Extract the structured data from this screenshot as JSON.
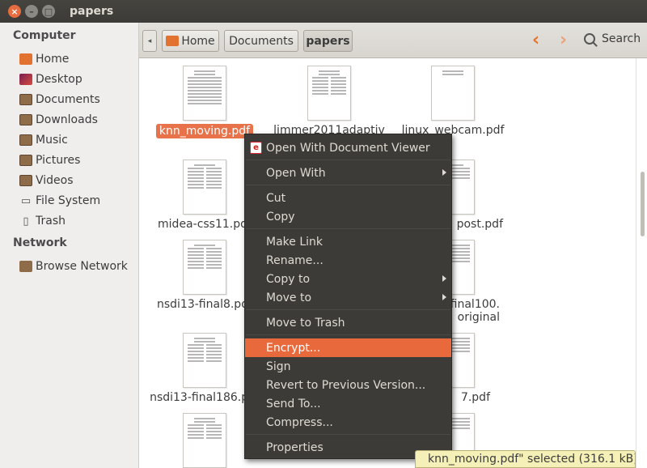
{
  "window": {
    "title": "papers"
  },
  "sidebar": {
    "sections": [
      {
        "heading": "Computer",
        "items": [
          {
            "label": "Home",
            "icon": "home-folder-icon"
          },
          {
            "label": "Desktop",
            "icon": "desktop-icon"
          },
          {
            "label": "Documents",
            "icon": "documents-folder-icon"
          },
          {
            "label": "Downloads",
            "icon": "downloads-folder-icon"
          },
          {
            "label": "Music",
            "icon": "music-folder-icon"
          },
          {
            "label": "Pictures",
            "icon": "pictures-folder-icon"
          },
          {
            "label": "Videos",
            "icon": "videos-folder-icon"
          },
          {
            "label": "File System",
            "icon": "filesystem-icon"
          },
          {
            "label": "Trash",
            "icon": "trash-icon"
          }
        ]
      },
      {
        "heading": "Network",
        "items": [
          {
            "label": "Browse Network",
            "icon": "network-icon"
          }
        ]
      }
    ]
  },
  "toolbar": {
    "breadcrumbs": [
      "Home",
      "Documents",
      "papers"
    ],
    "search_label": "Search"
  },
  "files": [
    {
      "name": "knn_moving.pdf",
      "selected": true
    },
    {
      "name": "limmer2011adaptiv"
    },
    {
      "name": "linux_webcam.pdf"
    },
    {
      "name": "midea-css11.pdf"
    },
    {
      "name": "post.pdf"
    },
    {
      "name": "nsdi13-final8.pdf"
    },
    {
      "name": "final100.",
      "name2": "original"
    },
    {
      "name": "nsdi13-final186.pdf"
    },
    {
      "name": "7.pdf"
    }
  ],
  "context_menu": {
    "items": [
      {
        "label": "Open With Document Viewer",
        "icon": "document-viewer-icon"
      },
      {
        "label": "Open With",
        "submenu": true
      },
      {
        "label": "Cut"
      },
      {
        "label": "Copy"
      },
      {
        "label": "Make Link"
      },
      {
        "label": "Rename..."
      },
      {
        "label": "Copy to",
        "submenu": true
      },
      {
        "label": "Move to",
        "submenu": true
      },
      {
        "label": "Move to Trash"
      },
      {
        "label": "Encrypt...",
        "highlighted": true
      },
      {
        "label": "Sign"
      },
      {
        "label": "Revert to Previous Version..."
      },
      {
        "label": "Send To..."
      },
      {
        "label": "Compress..."
      },
      {
        "label": "Properties"
      }
    ]
  },
  "status": {
    "text": "knn_moving.pdf\" selected (316.1 kB)"
  },
  "colors": {
    "accent": "#e8693b",
    "menu_bg": "#3c3b37",
    "titlebar": "#3c3b37",
    "status_bg": "#f5f0b8"
  }
}
